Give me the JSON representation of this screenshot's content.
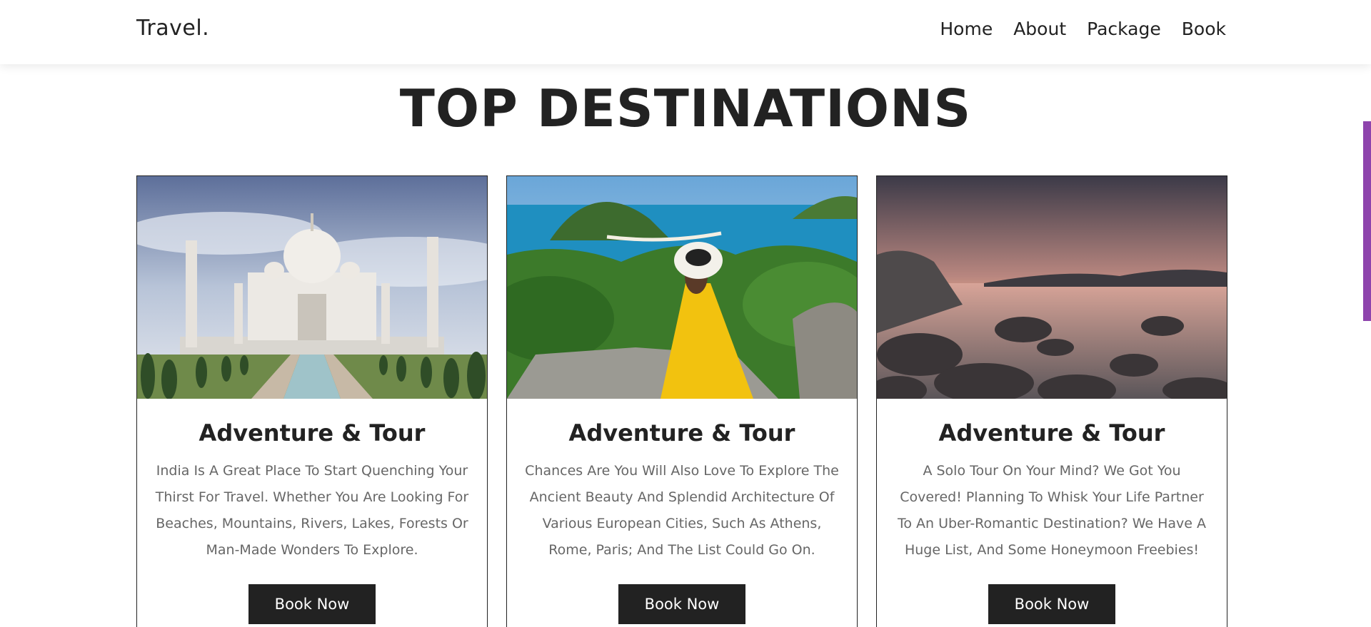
{
  "header": {
    "logo": "Travel.",
    "nav": [
      "Home",
      "About",
      "Package",
      "Book"
    ]
  },
  "section": {
    "title": "TOP DESTINATIONS"
  },
  "cards": [
    {
      "title": "Adventure & Tour",
      "text": "India Is A Great Place To Start Quenching Your Thirst For Travel. Whether You Are Looking For Beaches, Mountains, Rivers, Lakes, Forests Or Man-Made Wonders To Explore.",
      "button": "Book Now",
      "image": "taj-mahal-photo"
    },
    {
      "title": "Adventure & Tour",
      "text": "Chances Are You Will Also Love To Explore The Ancient Beauty And Splendid Architecture Of Various European Cities, Such As Athens, Rome, Paris; And The List Could Go On.",
      "button": "Book Now",
      "image": "woman-yellow-dress-island-photo"
    },
    {
      "title": "Adventure & Tour",
      "text": "A Solo Tour On Your Mind? We Got You Covered! Planning To Whisk Your Life Partner To An Uber-Romantic Destination? We Have A Huge List, And Some Honeymoon Freebies!",
      "button": "Book Now",
      "image": "sunset-rocky-lake-photo"
    }
  ],
  "colors": {
    "accent": "#8e44ad",
    "button": "#222222",
    "text_muted": "#666666"
  }
}
